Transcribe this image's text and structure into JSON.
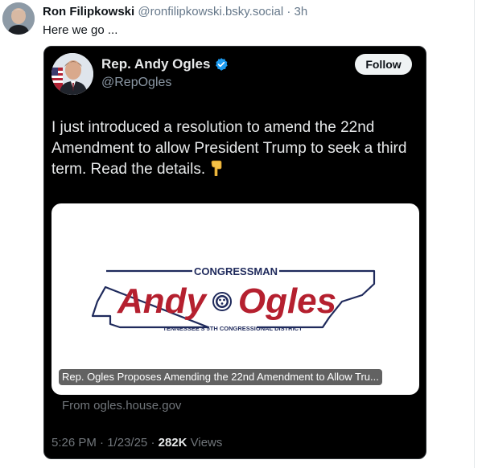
{
  "post": {
    "author_name": "Ron Filipkowski",
    "author_handle": "@ronfilipkowski.bsky.social",
    "separator": "·",
    "time": "3h",
    "text": "Here we go ..."
  },
  "embed": {
    "name": "Rep. Andy Ogles",
    "handle": "@RepOgles",
    "follow_label": "Follow",
    "text": "I just introduced a resolution to amend the 22nd Amendment to allow President Trump to seek a third term. Read the details.",
    "emoji": "pointing-down-icon",
    "card": {
      "logo_top": "CONGRESSMAN",
      "logo_first": "Andy",
      "logo_last": "Ogles",
      "logo_bottom": "TENNESSEE'S 5TH CONGRESSIONAL DISTRICT",
      "caption": "Rep. Ogles Proposes Amending the 22nd Amendment to Allow Tru...",
      "source": "From ogles.house.gov"
    },
    "footer": {
      "time": "5:26 PM",
      "date": "1/23/25",
      "sep": "·",
      "views_count": "282K",
      "views_label": "Views"
    }
  },
  "colors": {
    "verified": "#1d9bf0",
    "logo_red": "#b5202f",
    "logo_navy": "#1f2a5c"
  }
}
